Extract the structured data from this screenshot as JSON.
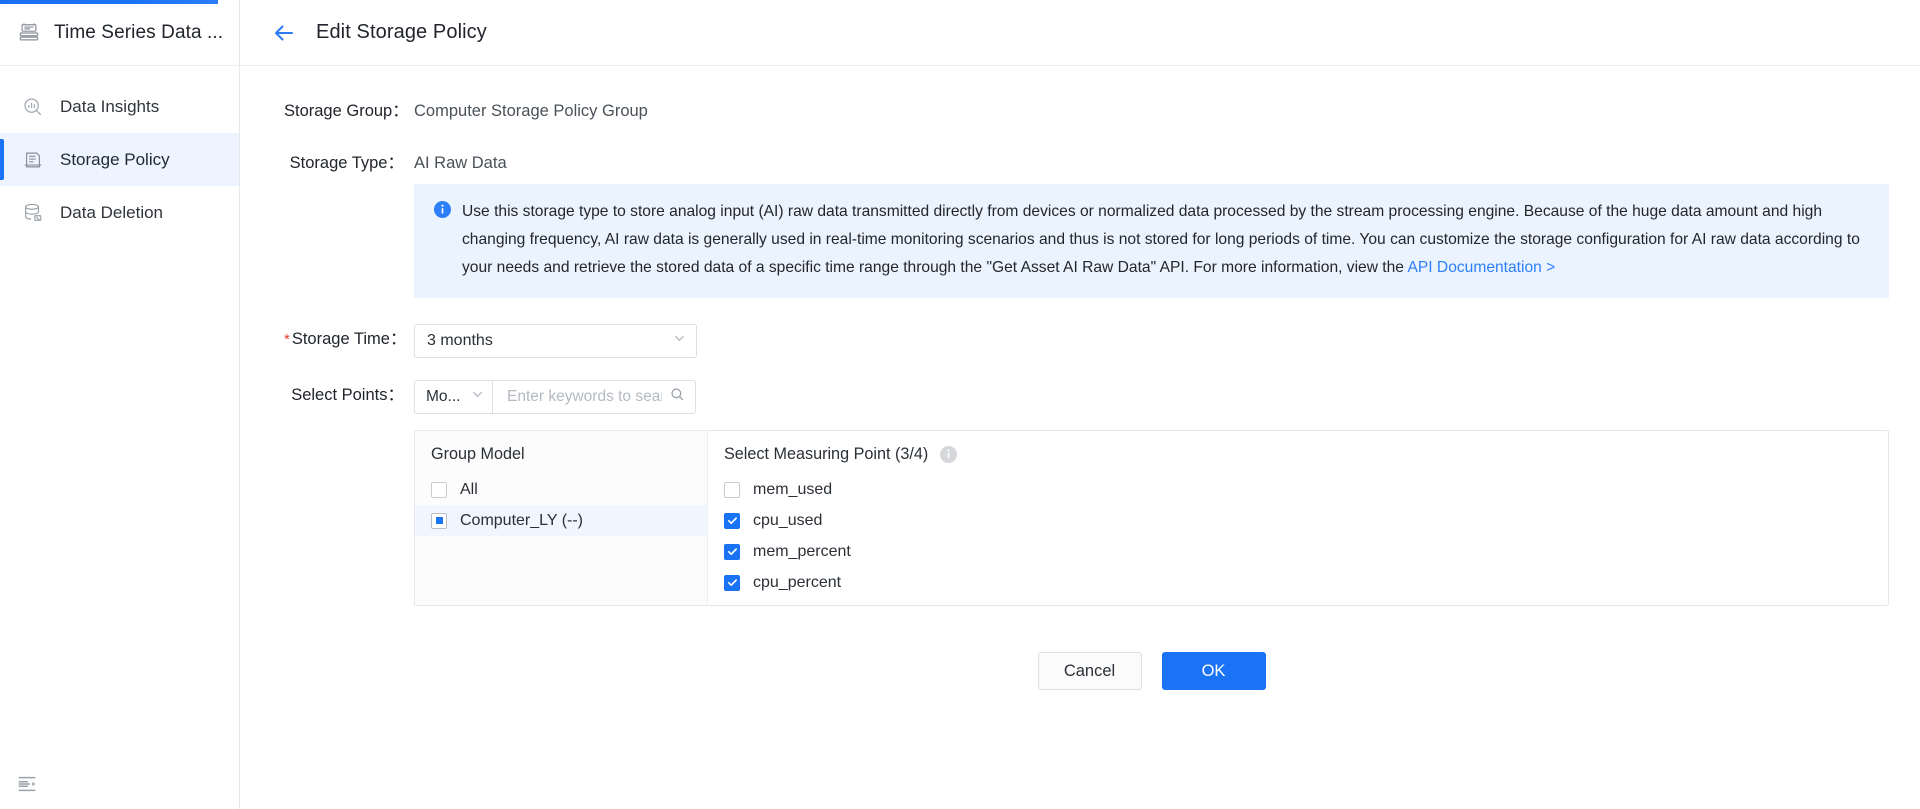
{
  "sidebar": {
    "brand": {
      "title": "Time Series Data ...",
      "icon": "timeseries-database-icon"
    },
    "items": [
      {
        "label": "Data Insights",
        "icon": "chart-search-icon",
        "active": false
      },
      {
        "label": "Storage Policy",
        "icon": "storage-policy-icon",
        "active": true
      },
      {
        "label": "Data Deletion",
        "icon": "database-delete-icon",
        "active": false
      }
    ],
    "collapse_icon": "collapse-sidebar-icon"
  },
  "header": {
    "back_icon": "back-arrow-icon",
    "title": "Edit Storage Policy"
  },
  "form": {
    "storage_group": {
      "label": "Storage Group：",
      "value": "Computer Storage Policy Group"
    },
    "storage_type": {
      "label": "Storage Type：",
      "value": "AI Raw Data"
    },
    "banner": {
      "icon": "info-circle-icon",
      "text": "Use this storage type to store analog input (AI) raw data transmitted directly from devices or normalized data processed by the stream processing engine. Because of the huge data amount and high changing frequency, AI raw data is generally used in real-time monitoring scenarios and thus is not stored for long periods of time. You can customize the storage configuration for AI raw data according to your needs and retrieve the stored data of a specific time range through the \"Get Asset AI Raw Data\" API. For more information, view the ",
      "link_text": "API Documentation >"
    },
    "storage_time": {
      "label": "Storage Time：",
      "required_mark": "*",
      "value": "3 months",
      "chevron_icon": "chevron-down-icon"
    },
    "select_points": {
      "label": "Select Points：",
      "mode_value": "Mo...",
      "mode_chevron_icon": "chevron-down-icon",
      "search_placeholder": "Enter keywords to sear...",
      "search_value": "",
      "search_icon": "search-icon"
    }
  },
  "transfer": {
    "left": {
      "header": "Group Model",
      "rows": [
        {
          "label": "All",
          "state": "unchecked"
        },
        {
          "label": "Computer_LY (--)",
          "state": "partial",
          "selected": true
        }
      ]
    },
    "right": {
      "header": "Select Measuring Point (3/4)",
      "info_icon": "info-tooltip-icon",
      "rows": [
        {
          "label": "mem_used",
          "state": "unchecked"
        },
        {
          "label": "cpu_used",
          "state": "checked"
        },
        {
          "label": "mem_percent",
          "state": "checked"
        },
        {
          "label": "cpu_percent",
          "state": "checked"
        }
      ]
    }
  },
  "footer": {
    "cancel_label": "Cancel",
    "ok_label": "OK"
  },
  "colors": {
    "accent": "#1a73f5",
    "banner_bg": "#eaf3fe",
    "active_nav_bg": "#edf3ff",
    "required_red": "#e8413a"
  }
}
